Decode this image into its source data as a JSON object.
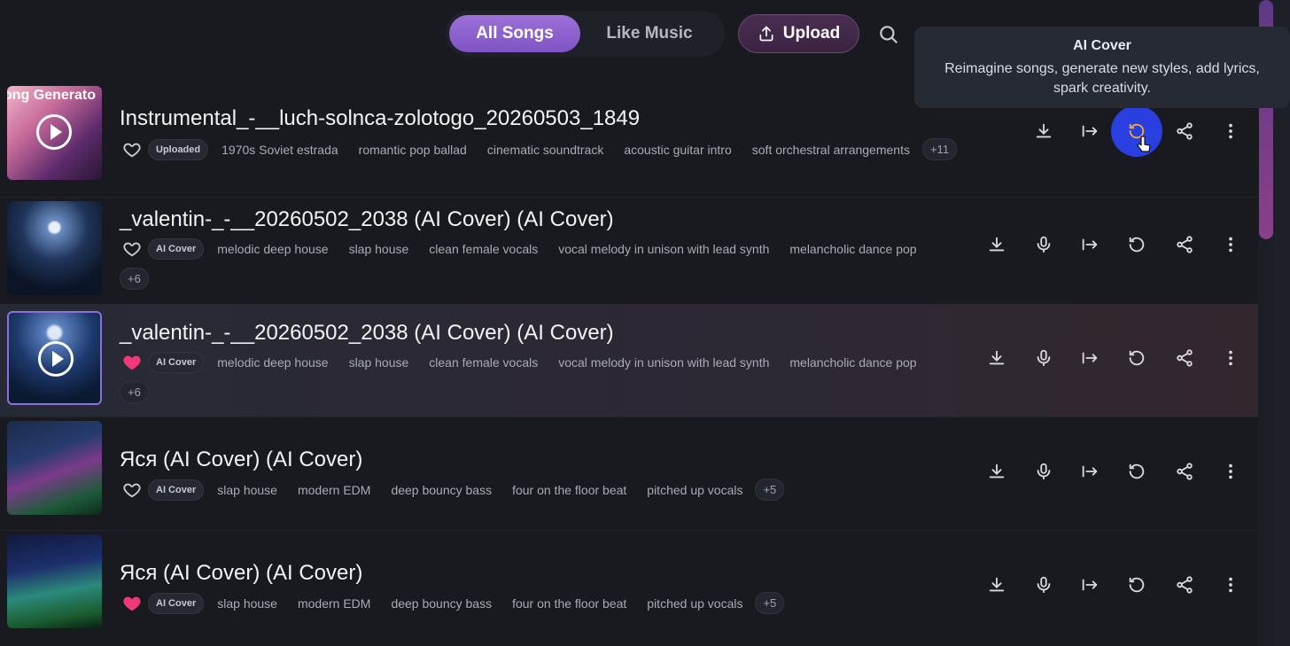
{
  "header": {
    "tabs": [
      {
        "label": "All Songs",
        "active": true
      },
      {
        "label": "Like Music",
        "active": false
      }
    ],
    "upload_label": "Upload",
    "search_icon": "search-icon"
  },
  "tooltip": {
    "title": "AI Cover",
    "description": "Reimagine songs, generate new styles, add lyrics, spark creativity."
  },
  "colors": {
    "accent": "#8c5fd0",
    "heart_liked": "#f0397a",
    "highlight": "#2a3fe0"
  },
  "songs": [
    {
      "title": "Instrumental_-__luch-solnca-zolotogo_20260503_1849",
      "thumb_label": "ong Generato",
      "liked": false,
      "badge": "Uploaded",
      "tags": [
        "1970s Soviet estrada",
        "romantic pop ballad",
        "cinematic soundtrack",
        "acoustic guitar intro",
        "soft orchestral arrangements"
      ],
      "more": "+11"
    },
    {
      "title": "_valentin-_-__20260502_2038 (AI Cover) (AI Cover)",
      "liked": false,
      "badge": "AI Cover",
      "tags": [
        "melodic deep house",
        "slap house",
        "clean female vocals",
        "vocal melody in unison with lead synth",
        "melancholic dance pop"
      ],
      "more": "+6"
    },
    {
      "title": "_valentin-_-__20260502_2038 (AI Cover) (AI Cover)",
      "liked": true,
      "badge": "AI Cover",
      "tags": [
        "melodic deep house",
        "slap house",
        "clean female vocals",
        "vocal melody in unison with lead synth",
        "melancholic dance pop"
      ],
      "more": "+6"
    },
    {
      "title": "Яся (AI Cover) (AI Cover)",
      "liked": false,
      "badge": "AI Cover",
      "tags": [
        "slap house",
        "modern EDM",
        "deep bouncy bass",
        "four on the floor beat",
        "pitched up vocals"
      ],
      "more": "+5"
    },
    {
      "title": "Яся (AI Cover) (AI Cover)",
      "liked": true,
      "badge": "AI Cover",
      "tags": [
        "slap house",
        "modern EDM",
        "deep bouncy bass",
        "four on the floor beat",
        "pitched up vocals"
      ],
      "more": "+5"
    }
  ]
}
